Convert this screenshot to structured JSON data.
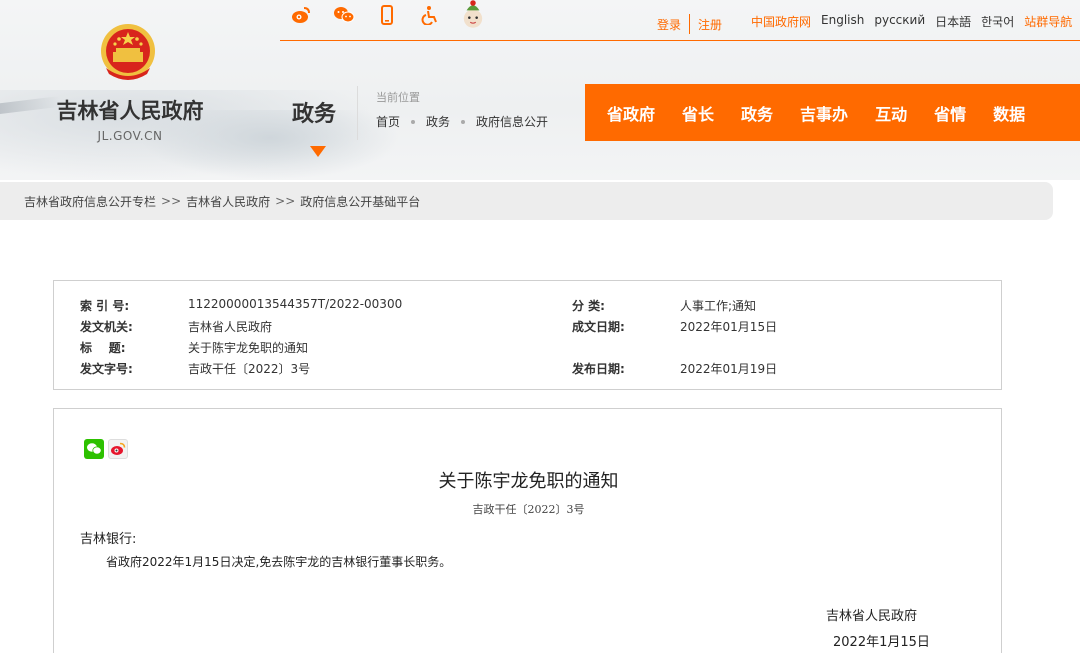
{
  "colors": {
    "accent": "#ff6a00",
    "nav_text": "#ffffff",
    "bar_bg": "#ededed"
  },
  "header": {
    "site_name": "吉林省人民政府",
    "site_domain": "JL.GOV.CN",
    "section_title": "政务",
    "location_label": "当前位置",
    "location_crumbs": [
      "首页",
      "政务",
      "政府信息公开"
    ],
    "top_icons": [
      "weibo-icon",
      "wechat-icon",
      "mobile-icon",
      "accessibility-icon",
      "mascot-icon"
    ],
    "login": "登录",
    "register": "注册",
    "links": {
      "china_gov": "中国政府网",
      "english": "English",
      "russian": "русский",
      "japanese": "日本語",
      "korean": "한국어",
      "site_nav": "站群导航"
    },
    "nav": [
      "省政府",
      "省长",
      "政务",
      "吉事办",
      "互动",
      "省情",
      "数据"
    ]
  },
  "breadcrumb": [
    "吉林省政府信息公开专栏",
    "吉林省人民政府",
    "政府信息公开基础平台"
  ],
  "breadcrumb_sep": ">>",
  "meta": {
    "index_label": "索 引 号:",
    "index_value": "11220000013544357T/2022-00300",
    "category_label": "分    类:",
    "category_value": "人事工作;通知",
    "issuer_label": "发文机关:",
    "issuer_value": "吉林省人民政府",
    "written_label": "成文日期:",
    "written_value": "2022年01月15日",
    "title_label": "标    题:",
    "title_value": "关于陈宇龙免职的通知",
    "docno_label": "发文字号:",
    "docno_value": "吉政干任〔2022〕3号",
    "published_label": "发布日期:",
    "published_value": "2022年01月19日"
  },
  "document": {
    "share_icons": [
      "wechat-share-icon",
      "weibo-share-icon"
    ],
    "title": "关于陈宇龙免职的通知",
    "doc_no": "吉政干任〔2022〕3号",
    "addressee": "吉林银行:",
    "body": "省政府2022年1月15日决定,免去陈宇龙的吉林银行董事长职务。",
    "sign_org": "吉林省人民政府",
    "sign_date": "2022年1月15日"
  }
}
